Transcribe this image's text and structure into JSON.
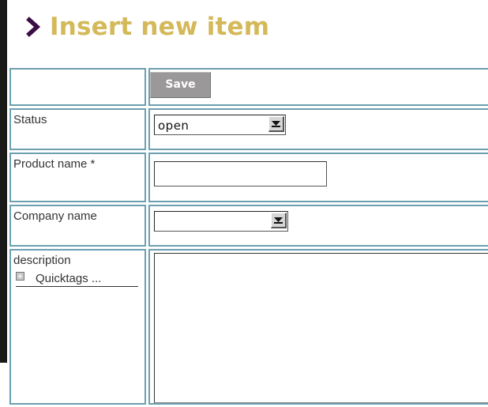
{
  "page": {
    "title": "Insert new item",
    "title_color": "#d4b95a",
    "chevron_color": "#3b0d45"
  },
  "toolbar": {
    "save_label": "Save"
  },
  "fields": {
    "status": {
      "label": "Status",
      "value": "open"
    },
    "product": {
      "label": "Product name *",
      "value": ""
    },
    "company": {
      "label": "Company name",
      "value": ""
    },
    "description": {
      "label": "description",
      "quicktags_label": "Quicktags ..."
    }
  }
}
